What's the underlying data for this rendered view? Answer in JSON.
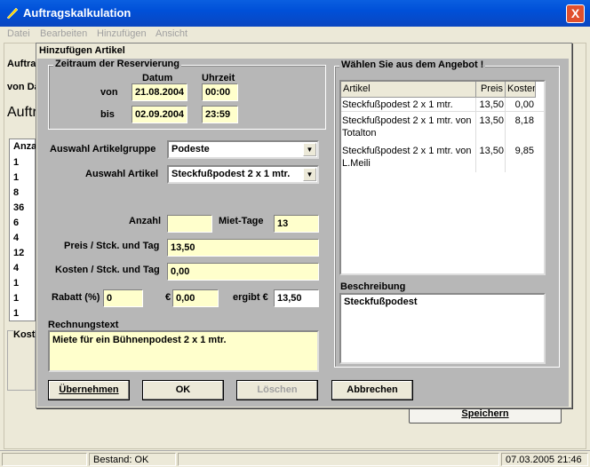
{
  "window": {
    "title": "Auftragskalkulation",
    "close": "X"
  },
  "menu": [
    "Datei",
    "Bearbeiten",
    "Hinzufügen",
    "Ansicht"
  ],
  "background": {
    "label1": "Auftra",
    "label2": "von Da",
    "title": "Auftr",
    "table_header": "Anza",
    "table_values": [
      "1",
      "1",
      "8",
      "36",
      "6",
      "4",
      "12",
      "4",
      "1",
      "1",
      "1"
    ],
    "costs_label": "Kost",
    "save_button": "Speichern"
  },
  "status": {
    "bestand": "Bestand: OK",
    "datetime": "07.03.2005 21:46"
  },
  "dialog": {
    "title": "Hinzufügen Artikel",
    "period": {
      "group_label": "Zeitraum der Reservierung",
      "col_datum": "Datum",
      "col_uhrzeit": "Uhrzeit",
      "von_label": "von",
      "bis_label": "bis",
      "von_datum": "21.08.2004",
      "von_uhrzeit": "00:00",
      "bis_datum": "02.09.2004",
      "bis_uhrzeit": "23:59"
    },
    "artikelgruppe_label": "Auswahl Artikelgruppe",
    "artikelgruppe_value": "Podeste",
    "artikel_label": "Auswahl Artikel",
    "artikel_value": "Steckfußpodest 2 x 1 mtr.",
    "anzahl_label": "Anzahl",
    "anzahl_value": "",
    "miettage_label": "Miet-Tage",
    "miettage_value": "13",
    "preis_label": "Preis / Stck. und Tag",
    "preis_value": "13,50",
    "kosten_label": "Kosten / Stck. und Tag",
    "kosten_value": "0,00",
    "rabatt_label": "Rabatt (%)",
    "rabatt_value": "0",
    "euro_label": "€",
    "euro_value": "0,00",
    "ergibt_label": "ergibt €",
    "ergibt_value": "13,50",
    "rechnungstext_label": "Rechnungstext",
    "rechnungstext_value": "Miete für ein Bühnenpodest 2 x 1 mtr.",
    "angebot": {
      "group_label": "Wählen Sie aus dem Angebot !",
      "headers": [
        "Artikel",
        "Preis",
        "Kosten"
      ],
      "rows": [
        {
          "artikel": "Steckfußpodest 2 x 1 mtr.",
          "preis": "13,50",
          "kosten": "0,00"
        },
        {
          "artikel": "Steckfußpodest 2 x 1 mtr. von Totalton",
          "preis": "13,50",
          "kosten": "8,18"
        },
        {
          "artikel": "Steckfußpodest 2 x 1 mtr. von L.Meili",
          "preis": "13,50",
          "kosten": "9,85"
        }
      ]
    },
    "beschreibung_label": "Beschreibung",
    "beschreibung_value": "Steckfußpodest",
    "buttons": {
      "uebernehmen": "Übernehmen",
      "ok": "OK",
      "loeschen": "Löschen",
      "abbrechen": "Abbrechen"
    }
  }
}
